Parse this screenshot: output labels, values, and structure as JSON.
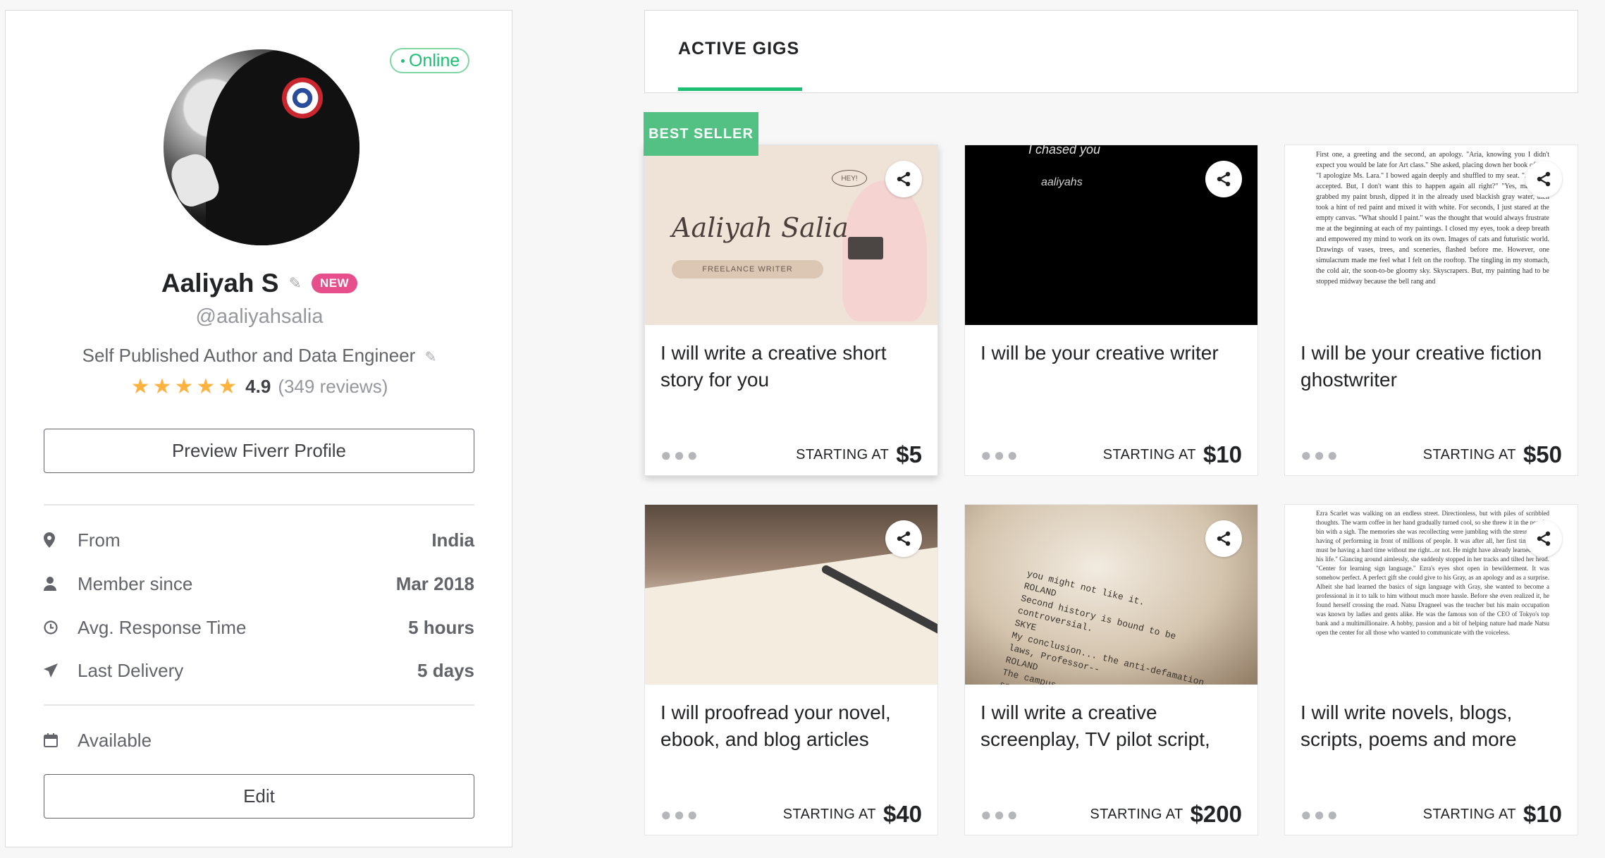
{
  "profile": {
    "status": "Online",
    "name": "Aaliyah S",
    "badge": "NEW",
    "username": "@aaliyahsalia",
    "tagline": "Self Published Author and Data Engineer",
    "rating": "4.9",
    "reviews": "(349 reviews)",
    "stars": 5,
    "preview_button": "Preview Fiverr Profile",
    "stats": {
      "from": {
        "label": "From",
        "value": "India",
        "icon": "location-pin-icon"
      },
      "member": {
        "label": "Member since",
        "value": "Mar 2018",
        "icon": "user-icon"
      },
      "response": {
        "label": "Avg. Response Time",
        "value": "5 hours",
        "icon": "clock-icon"
      },
      "delivery": {
        "label": "Last Delivery",
        "value": "5 days",
        "icon": "send-icon"
      }
    },
    "availability": {
      "label": "Available",
      "icon": "calendar-icon"
    },
    "edit_button": "Edit"
  },
  "tabs": {
    "active": "ACTIVE GIGS"
  },
  "best_seller_label": "BEST SELLER",
  "starting_at_label": "STARTING AT",
  "gigs": [
    {
      "title": "I will write a creative short story for you",
      "price": "$5"
    },
    {
      "title": "I will be your creative writer",
      "price": "$10"
    },
    {
      "title": "I will be your creative fiction ghostwriter",
      "price": "$50"
    },
    {
      "title": "I will proofread your novel, ebook, and blog articles",
      "price": "$40"
    },
    {
      "title": "I will write a creative screenplay, TV pilot script,",
      "price": "$200"
    },
    {
      "title": "I will write novels, blogs, scripts, poems and more",
      "price": "$10"
    }
  ],
  "thumbnails": {
    "gig1_title": "Aaliyah Salia",
    "gig1_subtitle": "FREELANCE WRITER",
    "gig1_bubble": "HEY!",
    "gig2_line1": "I chased you",
    "gig2_line2": "aaliyahs",
    "gig3_text": "First one, a greeting and the second, an apology. \"Aria, knowing you I didn't expect you would be late for Art class.\" She asked, placing down her book of arts. \"I apologize Ms. Lara.\" I bowed again deeply and shuffled to my seat. \"Apology accepted. But, I don't want this to happen again all right?\" \"Yes, ma'am.\" I grabbed my paint brush, dipped it in the already used blackish gray water, then took a hint of red paint and mixed it with white. For seconds, I just stared at the empty canvas. \"What should I paint.\" was the thought that would always frustrate me at the beginning at each of my paintings. I closed my eyes, took a deep breath and empowered my mind to work on its own. Images of cats and futuristic world. Drawings of vases, trees, and sceneries, flashed before me. However, one simulacrum made me feel what I felt on the rooftop. The tingling in my stomach, the cold air, the soon-to-be gloomy sky. Skyscrapers. But, my painting had to be stopped midway because the bell rang and",
    "gig5_text": "you might not like it.\nROLAND\nSecond history is bound to be\ncontroversial.\nSKYE\nMy conclusion... the anti-defamation\nlaws, Professor--\nROLAND\nThe campus, even a virtual one, is a\nspeech zone. I want to hear your\nopinions on the war, Washington's\neffects. Everything.",
    "gig6_text": "Ezra Scarlet was walking on an endless street. Directionless, but with piles of scribbled thoughts. The warm coffee in her hand gradually turned cool, so she threw it in the near-by bin with a sigh. The memories she was recollecting were jumbling with the stress she was having of performing in front of millions of people. It was after all, her first time. \"Gray must be having a hard time without me right...or not. He might have already learned to live his life.\" Glancing around aimlessly, she suddenly stopped in her tracks and tilted her head. \"Center for learning sign language.\" Ezra's eyes shot open in bewilderment. It was somehow perfect. A perfect gift she could give to his Gray, as an apology and as a surprise. Albeit she had learned the basics of sign language with Gray, she wanted to become a professional in it to talk to him without much more hassle. Before she even realized it, he found herself crossing the road. Natsu Dragneel was the teacher but his main occupation was known by ladies and gents alike. He was the famous son of the CEO of Tokyo's top bank and a multimillionaire. A hobby, passion and a bit of helping nature had made Natsu open the center for all those who wanted to communicate with the voiceless."
  },
  "colors": {
    "accent_green": "#1dbf73",
    "best_seller_green": "#53c184",
    "new_badge_pink": "#e64f8c",
    "star_yellow": "#ffb33e"
  }
}
